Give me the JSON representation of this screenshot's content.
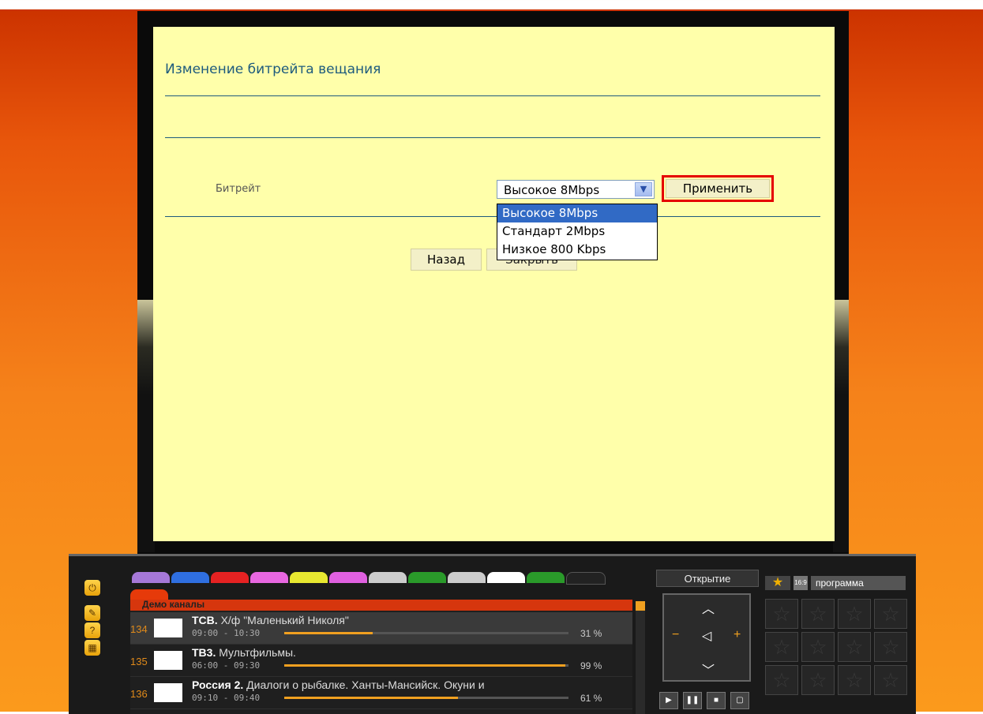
{
  "dialog": {
    "title": "Изменение битрейта вещания",
    "bitrate_label": "Битрейт",
    "selected_value": "Высокое 8Mbps",
    "apply_label": "Применить",
    "options": [
      "Высокое 8Mbps",
      "Стандарт 2Mbps",
      "Низкое 800 Kbps"
    ],
    "back_label": "Назад",
    "close_label": "Закрыть"
  },
  "player": {
    "list_header": "Демо каналы",
    "channels": [
      {
        "num": "134",
        "name": "ТСВ.",
        "show": "Х/ф \"Маленький Николя\"",
        "time": "09:00 - 10:30",
        "progress": 0.31,
        "pct": "31 %"
      },
      {
        "num": "135",
        "name": "ТВ3.",
        "show": "Мультфильмы.",
        "time": "06:00 - 09:30",
        "progress": 0.99,
        "pct": "99 %"
      },
      {
        "num": "136",
        "name": "Россия 2.",
        "show": "Диалоги о рыбалке. Ханты-Мансийск. Окуни и",
        "time": "09:10 - 09:40",
        "progress": 0.61,
        "pct": "61 %"
      }
    ],
    "control_title": "Открытие",
    "favorites_label": "программа",
    "aspect_label": "16:9"
  },
  "colors": {
    "accent_red": "#e50000",
    "screen_bg": "#ffffaa",
    "progress": "#f0a020",
    "tabs": [
      "#a678d8",
      "#2f6fe0",
      "#e62222",
      "#e867e0",
      "#e8e830",
      "#e060e0",
      "#cccccc",
      "#2a9a2a",
      "#cccccc",
      "#ffffff",
      "#2a9a2a",
      "#222222"
    ]
  }
}
